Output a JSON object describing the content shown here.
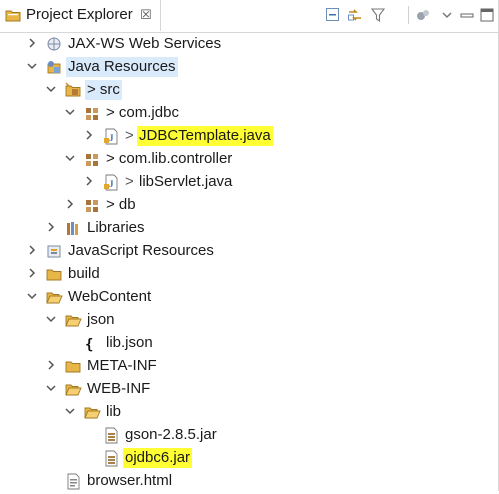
{
  "view": {
    "tab_title": "Project Explorer",
    "tab_close": "☒",
    "toolbar": [
      "collapse-all-icon",
      "link-with-editor-icon",
      "filter-icon",
      "view-menu-icon",
      "minimize-icon",
      "maximize-icon"
    ]
  },
  "tree": [
    {
      "label": "JAX-WS Web Services",
      "depth": 1,
      "expanded": false,
      "icon": "webservices-icon",
      "name": "jaxws-web-services"
    },
    {
      "label": "Java Resources",
      "depth": 1,
      "expanded": true,
      "icon": "java-resources-icon",
      "name": "java-resources",
      "selected": true
    },
    {
      "label": "> src",
      "depth": 2,
      "expanded": true,
      "icon": "source-folder-icon",
      "name": "src",
      "selected": true
    },
    {
      "label": "> com.jdbc",
      "depth": 3,
      "expanded": true,
      "icon": "package-icon",
      "name": "package-com-jdbc"
    },
    {
      "label": "JDBCTemplate.java",
      "depth": 4,
      "expanded": false,
      "icon": "java-file-icon",
      "name": "jdbctemplate-java",
      "prefix": ">",
      "highlight": true
    },
    {
      "label": "> com.lib.controller",
      "depth": 3,
      "expanded": true,
      "icon": "package-icon",
      "name": "package-com-lib-controller"
    },
    {
      "label": "libServlet.java",
      "depth": 4,
      "expanded": false,
      "icon": "java-file-icon",
      "name": "libservlet-java",
      "prefix": ">"
    },
    {
      "label": "> db",
      "depth": 3,
      "expanded": false,
      "icon": "package-icon",
      "name": "package-db"
    },
    {
      "label": "Libraries",
      "depth": 2,
      "expanded": false,
      "icon": "libraries-icon",
      "name": "libraries"
    },
    {
      "label": "JavaScript Resources",
      "depth": 1,
      "expanded": false,
      "icon": "js-resources-icon",
      "name": "javascript-resources"
    },
    {
      "label": "build",
      "depth": 1,
      "expanded": false,
      "icon": "folder-icon",
      "name": "build-folder"
    },
    {
      "label": "WebContent",
      "depth": 1,
      "expanded": true,
      "icon": "folder-open-icon",
      "name": "webcontent-folder"
    },
    {
      "label": "json",
      "depth": 2,
      "expanded": true,
      "icon": "folder-open-icon",
      "name": "json-folder"
    },
    {
      "label": "lib.json",
      "depth": 3,
      "expanded": null,
      "icon": "json-file-icon",
      "name": "lib-json-file"
    },
    {
      "label": "META-INF",
      "depth": 2,
      "expanded": false,
      "icon": "folder-icon",
      "name": "meta-inf-folder"
    },
    {
      "label": "WEB-INF",
      "depth": 2,
      "expanded": true,
      "icon": "folder-open-icon",
      "name": "web-inf-folder"
    },
    {
      "label": "lib",
      "depth": 3,
      "expanded": true,
      "icon": "folder-open-icon",
      "name": "lib-folder"
    },
    {
      "label": "gson-2.8.5.jar",
      "depth": 4,
      "expanded": null,
      "icon": "jar-file-icon",
      "name": "gson-jar"
    },
    {
      "label": "ojdbc6.jar",
      "depth": 4,
      "expanded": null,
      "icon": "jar-file-icon",
      "name": "ojdbc6-jar",
      "highlight": true
    },
    {
      "label": "browser.html",
      "depth": 2,
      "expanded": null,
      "icon": "html-file-icon",
      "name": "browser-html"
    }
  ],
  "colors": {
    "highlight": "#ffff33",
    "selection": "#d9eafb",
    "folder": "#e8b547",
    "java": "#3b6fb6",
    "package": "#a8743a"
  }
}
